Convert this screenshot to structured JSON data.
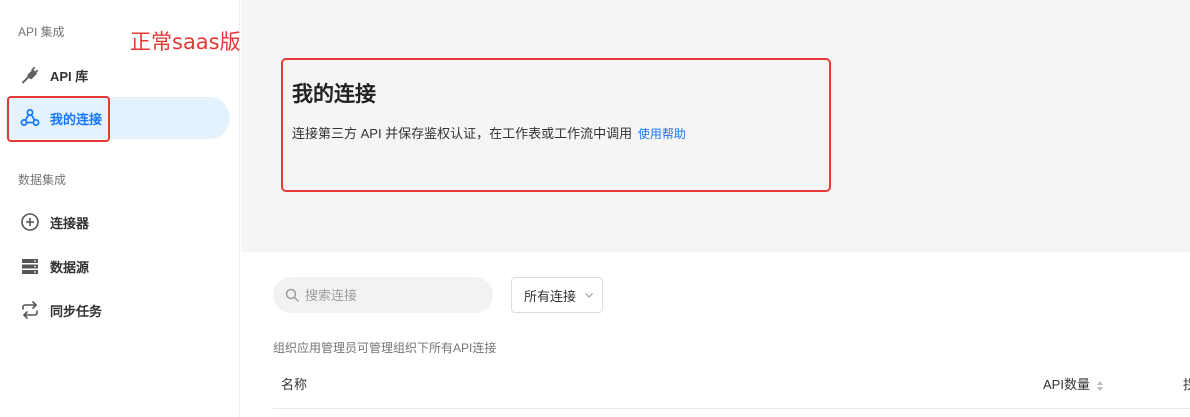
{
  "annotation": {
    "label": "正常saas版"
  },
  "sidebar": {
    "section1_title": "API 集成",
    "items1": [
      {
        "label": "API 库",
        "icon": "plug-icon"
      },
      {
        "label": "我的连接",
        "icon": "webhook-icon",
        "active": true
      }
    ],
    "section2_title": "数据集成",
    "items2": [
      {
        "label": "连接器",
        "icon": "plus-circle-icon"
      },
      {
        "label": "数据源",
        "icon": "server-icon"
      },
      {
        "label": "同步任务",
        "icon": "sync-icon"
      }
    ]
  },
  "main": {
    "title": "我的连接",
    "description": "连接第三方 API 并保存鉴权认证，在工作表或工作流中调用",
    "help_link": "使用帮助",
    "search_placeholder": "搜索连接",
    "filter_label": "所有连接",
    "hint": "组织应用管理员可管理组织下所有API连接",
    "columns": [
      "名称",
      "API数量",
      "拐"
    ]
  },
  "colors": {
    "accent": "#1677ff",
    "annotation": "#e53935",
    "active_bg": "#e3f2fd"
  }
}
